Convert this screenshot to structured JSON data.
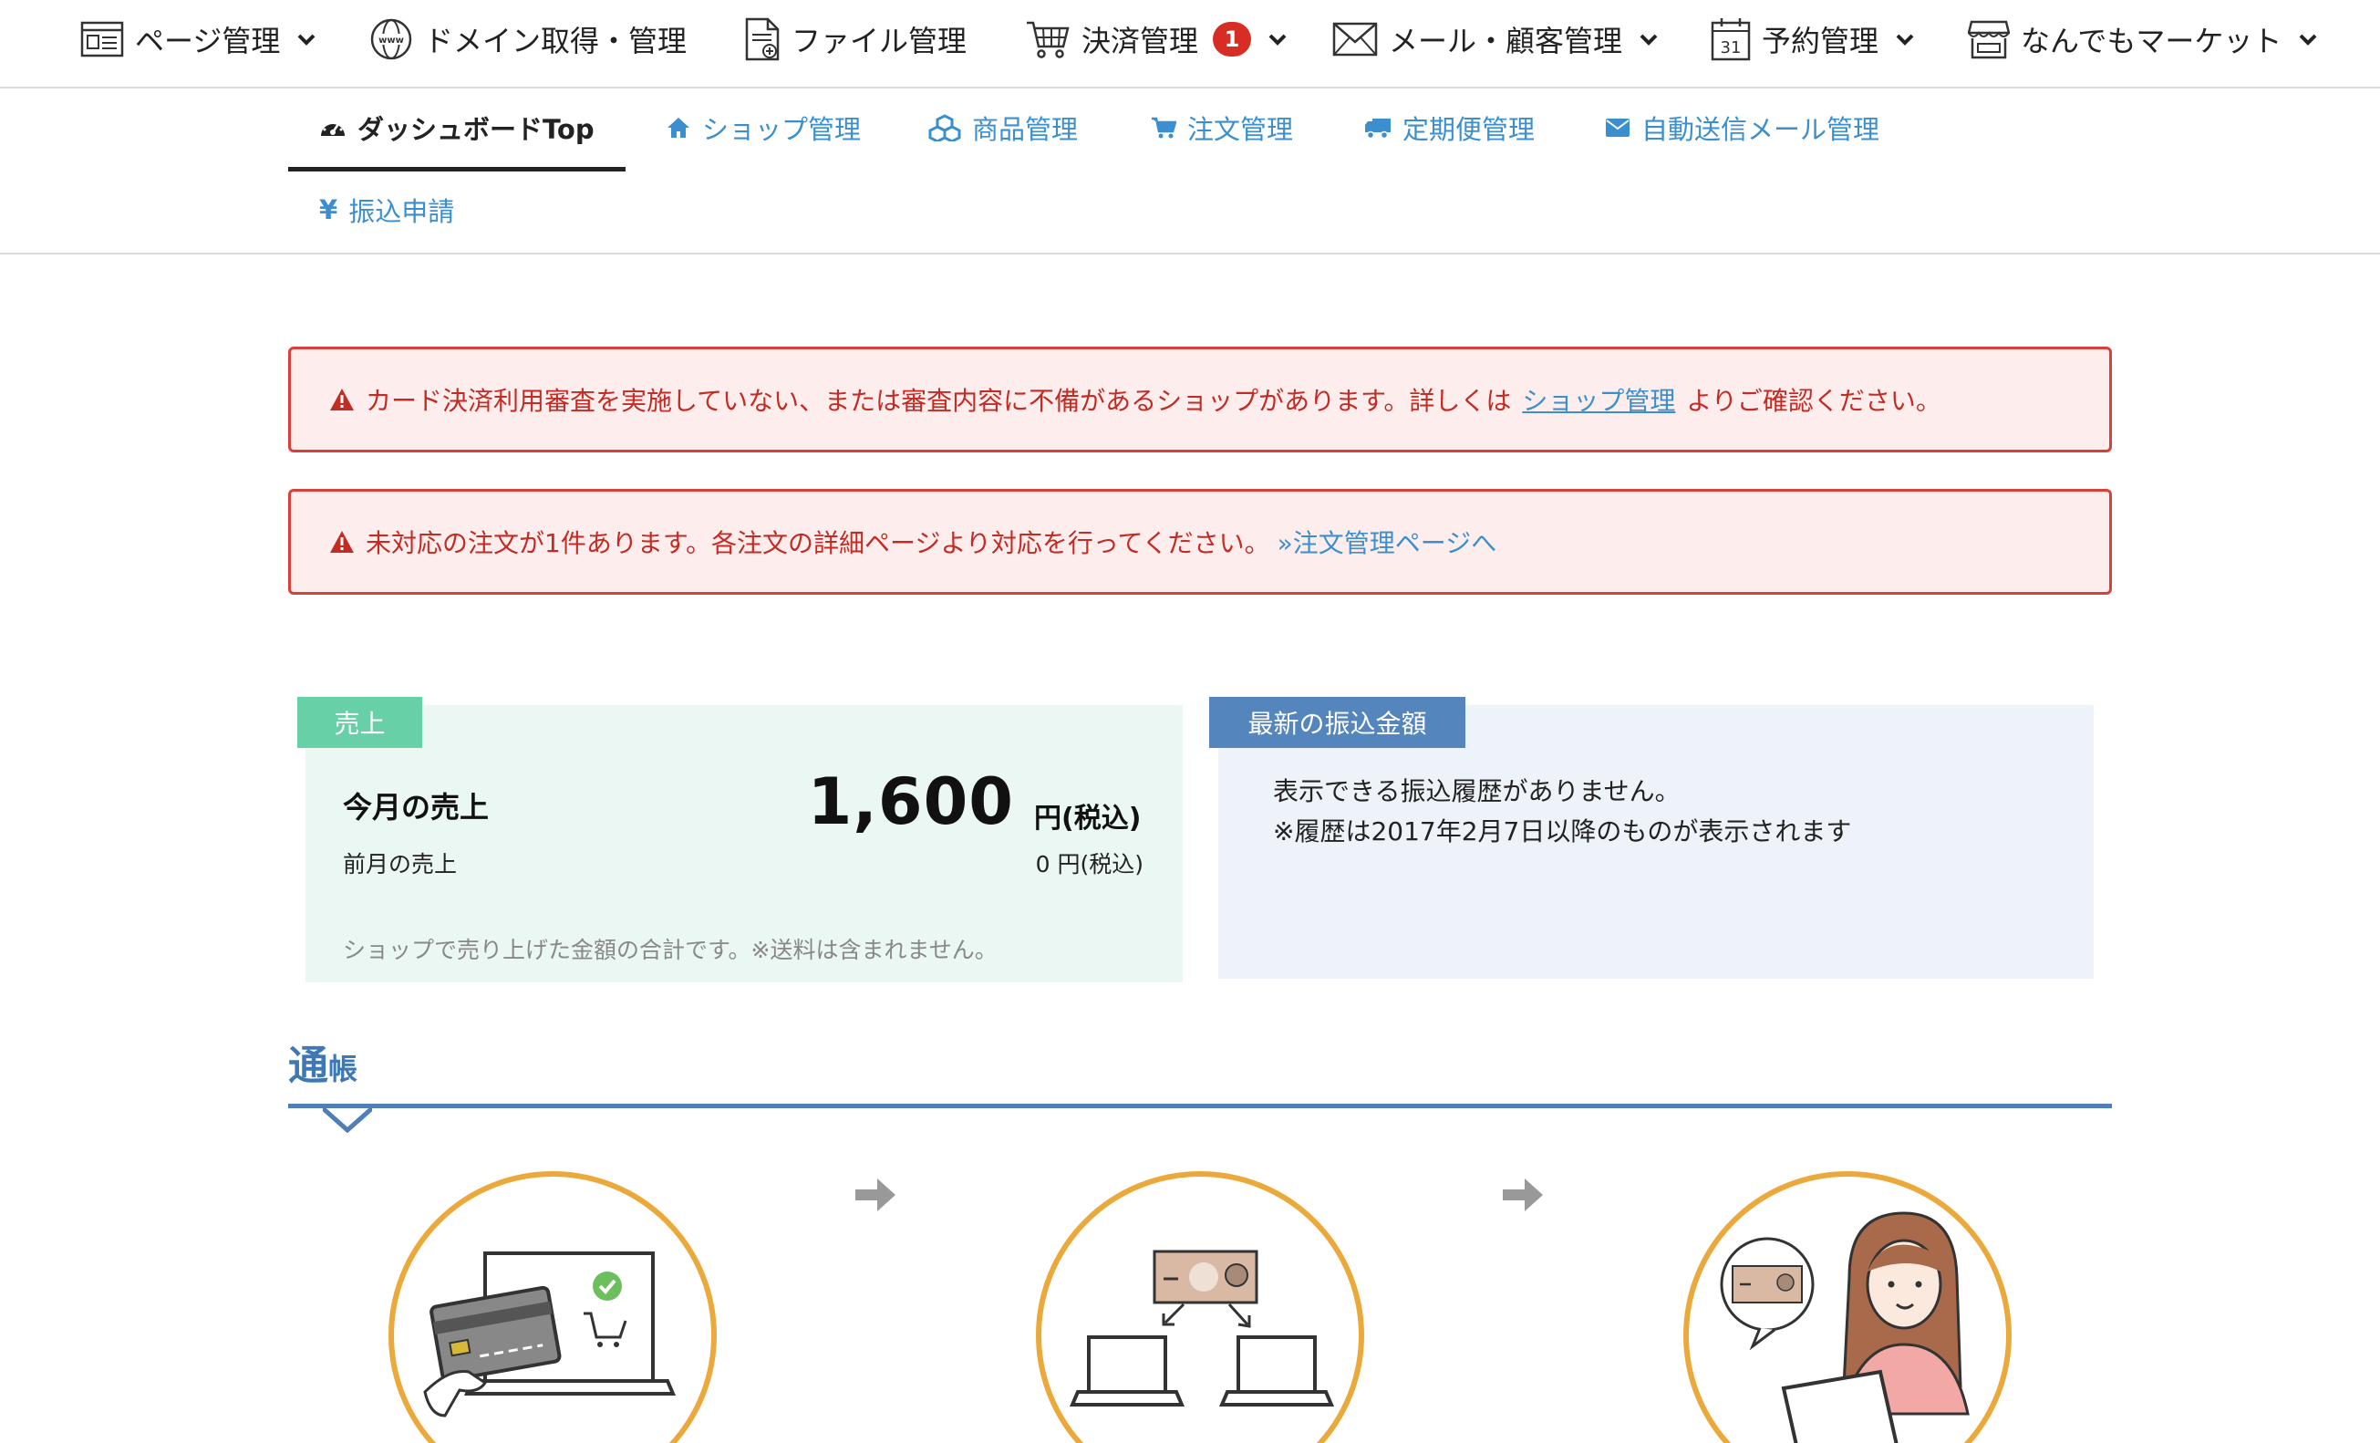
{
  "top_nav": {
    "items": [
      {
        "label": "ページ管理",
        "icon": "page-icon",
        "has_chevron": true
      },
      {
        "label": "ドメイン取得・管理",
        "icon": "globe-www-icon",
        "has_chevron": false
      },
      {
        "label": "ファイル管理",
        "icon": "file-icon",
        "has_chevron": false
      },
      {
        "label": "決済管理",
        "icon": "cart-icon",
        "has_chevron": true,
        "badge": "1"
      },
      {
        "label": "メール・顧客管理",
        "icon": "mail-icon",
        "has_chevron": true
      },
      {
        "label": "予約管理",
        "icon": "calendar-icon",
        "has_chevron": true,
        "calendar_day": "31"
      },
      {
        "label": "なんでもマーケット",
        "icon": "shop-icon",
        "has_chevron": true
      }
    ]
  },
  "sub_nav": {
    "tabs": [
      {
        "label": "ダッシュボードTop",
        "icon": "dashboard-icon",
        "active": true
      },
      {
        "label": "ショップ管理",
        "icon": "home-icon"
      },
      {
        "label": "商品管理",
        "icon": "cubes-icon"
      },
      {
        "label": "注文管理",
        "icon": "cart-icon"
      },
      {
        "label": "定期便管理",
        "icon": "truck-icon"
      },
      {
        "label": "自動送信メール管理",
        "icon": "envelope-icon"
      },
      {
        "label": "振込申請",
        "icon": "yen-icon",
        "icon_glyph": "¥"
      }
    ]
  },
  "alerts": {
    "card_review": {
      "text_before": "カード決済利用審査を実施していない、または審査内容に不備があるショップがあります。詳しくは",
      "link": "ショップ管理",
      "text_after": "よりご確認ください。"
    },
    "pending_order": {
      "text": "未対応の注文が1件あります。各注文の詳細ページより対応を行ってください。",
      "link": "»注文管理ページへ"
    }
  },
  "sales": {
    "tag": "売上",
    "this_month_label": "今月の売上",
    "this_month_value": "1,600",
    "this_month_unit": "円(税込)",
    "last_month_label": "前月の売上",
    "last_month_value": "0 円(税込)",
    "note": "ショップで売り上げた金額の合計です。※送料は含まれません。"
  },
  "transfer": {
    "tag": "最新の振込金額",
    "line1": "表示できる振込履歴がありません。",
    "line2": "※履歴は2017年2月7日以降のものが表示されます"
  },
  "passbook": {
    "title_big": "通",
    "title_small": "帳"
  },
  "colors": {
    "accent_blue": "#3b8fcf",
    "alert_red": "#d9403a",
    "sales_green": "#67d0a6",
    "transfer_blue": "#5585bd",
    "step_orange": "#eca93b"
  }
}
